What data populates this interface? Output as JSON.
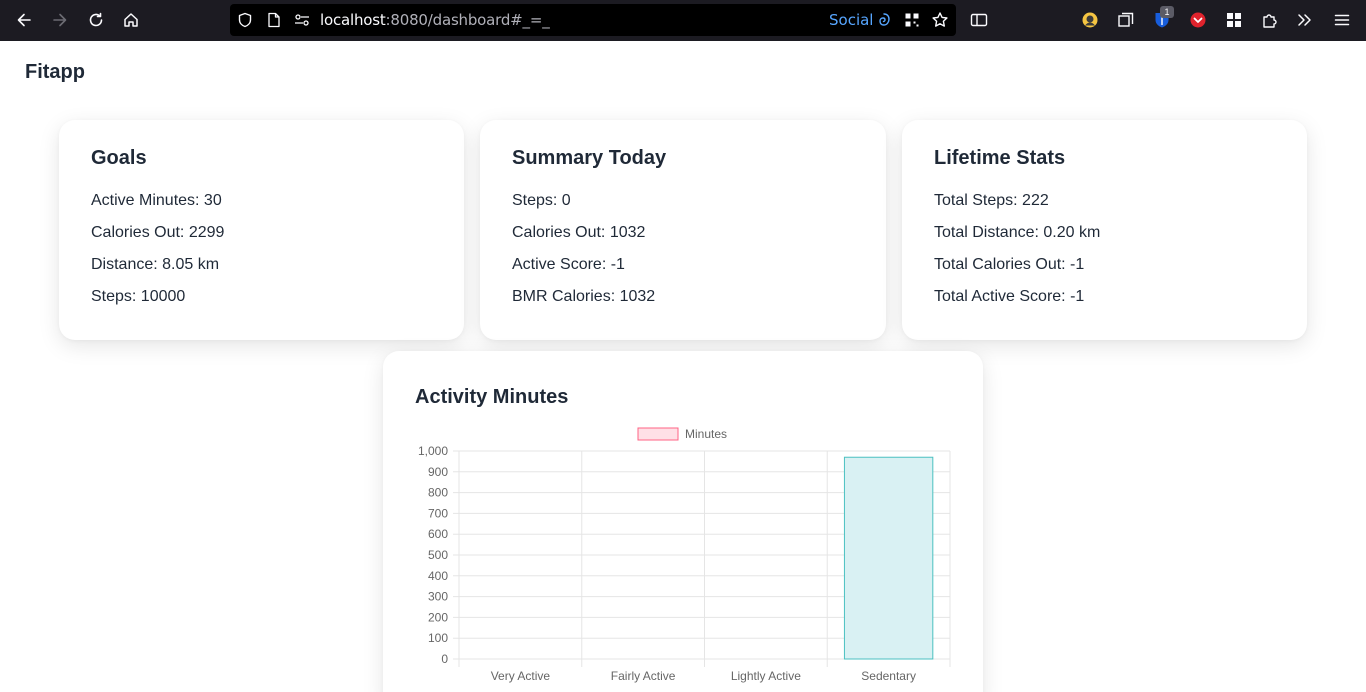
{
  "browser": {
    "url_host": "localhost",
    "url_rest": ":8080/dashboard#_=_",
    "social_label": "Social",
    "extension_badge": "1"
  },
  "app": {
    "brand": "Fitapp"
  },
  "goals": {
    "title": "Goals",
    "rows": [
      "Active Minutes: 30",
      "Calories Out: 2299",
      "Distance: 8.05 km",
      "Steps: 10000"
    ]
  },
  "summary": {
    "title": "Summary Today",
    "rows": [
      "Steps: 0",
      "Calories Out: 1032",
      "Active Score: -1",
      "BMR Calories: 1032"
    ]
  },
  "lifetime": {
    "title": "Lifetime Stats",
    "rows": [
      "Total Steps: 222",
      "Total Distance: 0.20 km",
      "Total Calories Out: -1",
      "Total Active Score: -1"
    ]
  },
  "activity": {
    "title": "Activity Minutes"
  },
  "chart_data": {
    "type": "bar",
    "categories": [
      "Very Active",
      "Fairly Active",
      "Lightly Active",
      "Sedentary"
    ],
    "series": [
      {
        "name": "Minutes",
        "values": [
          0,
          0,
          0,
          970
        ]
      }
    ],
    "ylim": [
      0,
      1000
    ],
    "yticks": [
      "1,000",
      "900",
      "800",
      "700",
      "600",
      "500",
      "400",
      "300",
      "200",
      "100",
      "0"
    ],
    "legend": "top",
    "grid": true,
    "colors": {
      "legend_fill": "#ffe0e6",
      "legend_stroke": "#ff6384",
      "bar_fill": "#d9f1f3",
      "bar_stroke": "#4bc0c0"
    }
  }
}
